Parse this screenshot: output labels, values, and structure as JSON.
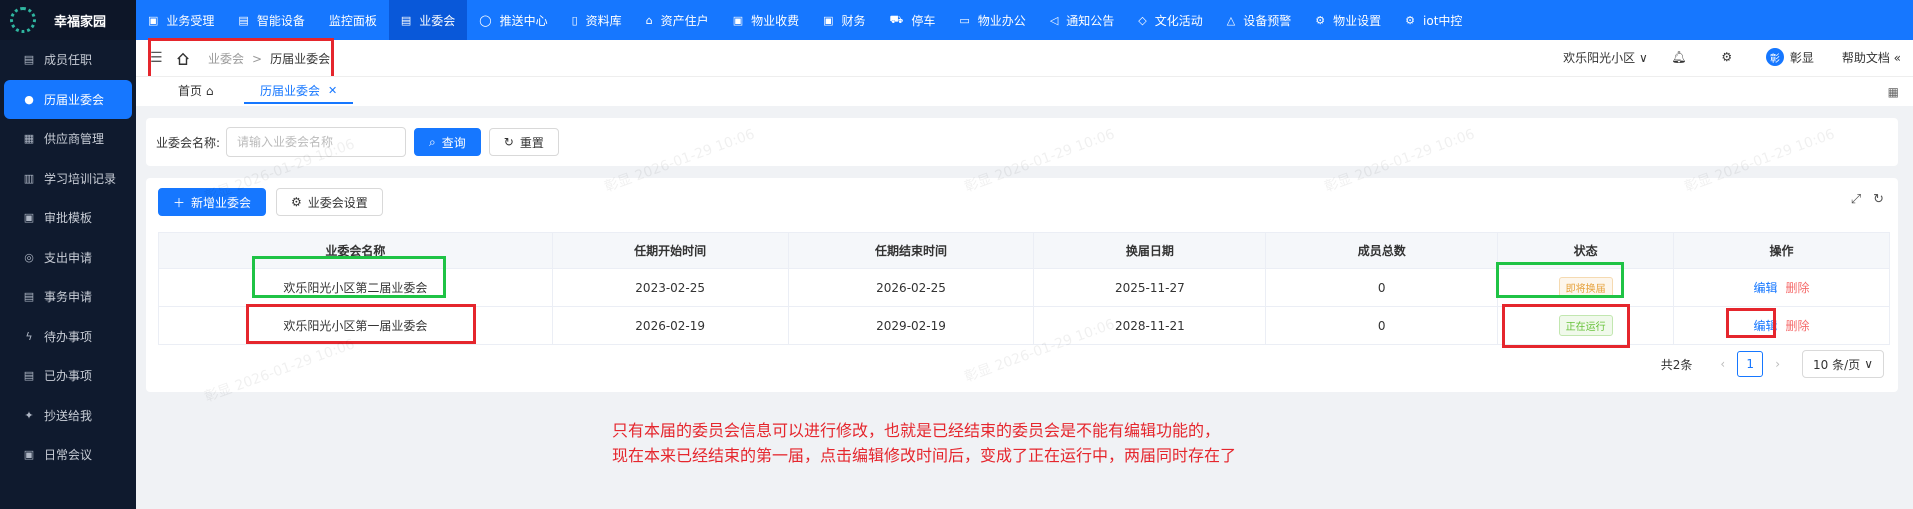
{
  "app": {
    "title": "幸福家园"
  },
  "sidebar": {
    "items": [
      {
        "label": "成员任职",
        "icon": "id-card-icon",
        "glyph": "▤"
      },
      {
        "label": "历届业委会",
        "icon": "users-icon",
        "glyph": "●",
        "active": true
      },
      {
        "label": "供应商管理",
        "icon": "supplier-icon",
        "glyph": "▦"
      },
      {
        "label": "学习培训记录",
        "icon": "book-icon",
        "glyph": "▥"
      },
      {
        "label": "审批模板",
        "icon": "template-icon",
        "glyph": "▣"
      },
      {
        "label": "支出申请",
        "icon": "coin-icon",
        "glyph": "◎"
      },
      {
        "label": "事务申请",
        "icon": "document-icon",
        "glyph": "▤"
      },
      {
        "label": "待办事项",
        "icon": "lightning-icon",
        "glyph": "ϟ"
      },
      {
        "label": "已办事项",
        "icon": "list-icon",
        "glyph": "▤"
      },
      {
        "label": "抄送给我",
        "icon": "bird-icon",
        "glyph": "✦"
      },
      {
        "label": "日常会议",
        "icon": "calendar-icon",
        "glyph": "▣"
      }
    ]
  },
  "topnav": {
    "items": [
      {
        "label": "业务受理",
        "icon": "business-icon",
        "glyph": "▣"
      },
      {
        "label": "智能设备",
        "icon": "device-icon",
        "glyph": "▤"
      },
      {
        "label": "监控面板",
        "icon": "monitor-icon",
        "glyph": ""
      },
      {
        "label": "业委会",
        "icon": "committee-icon",
        "glyph": "▤",
        "active": true
      },
      {
        "label": "推送中心",
        "icon": "chat-icon",
        "glyph": "◯"
      },
      {
        "label": "资料库",
        "icon": "file-icon",
        "glyph": "▯"
      },
      {
        "label": "资产住户",
        "icon": "home-icon",
        "glyph": "⌂"
      },
      {
        "label": "物业收费",
        "icon": "bill-icon",
        "glyph": "▣"
      },
      {
        "label": "财务",
        "icon": "finance-icon",
        "glyph": "▣"
      },
      {
        "label": "停车",
        "icon": "car-icon",
        "glyph": "⛟"
      },
      {
        "label": "物业办公",
        "icon": "desktop-icon",
        "glyph": "▭"
      },
      {
        "label": "通知公告",
        "icon": "megaphone-icon",
        "glyph": "◁"
      },
      {
        "label": "文化活动",
        "icon": "tag-icon",
        "glyph": "◇"
      },
      {
        "label": "设备预警",
        "icon": "alarm-icon",
        "glyph": "△"
      },
      {
        "label": "物业设置",
        "icon": "gear-icon",
        "glyph": "⚙"
      },
      {
        "label": "iot中控",
        "icon": "iot-icon",
        "glyph": "⚙"
      }
    ]
  },
  "header": {
    "breadcrumb": [
      "业委会",
      "历届业委会"
    ],
    "community": "欢乐阳光小区",
    "username": "彰显",
    "avatar_initial": "彰",
    "help": "帮助文档"
  },
  "tabs": [
    {
      "label": "首页"
    },
    {
      "label": "历届业委会",
      "active": true
    }
  ],
  "search": {
    "label": "业委会名称:",
    "placeholder": "请输入业委会名称",
    "query_btn": "查询",
    "reset_btn": "重置"
  },
  "toolbar": {
    "add_btn": "新增业委会",
    "settings_btn": "业委会设置"
  },
  "table": {
    "headers": [
      "业委会名称",
      "任期开始时间",
      "任期结束时间",
      "换届日期",
      "成员总数",
      "状态",
      "操作"
    ],
    "rows": [
      {
        "name": "欢乐阳光小区第二届业委会",
        "start": "2023-02-25",
        "end": "2026-02-25",
        "change": "2025-11-27",
        "members": "0",
        "status": "即将换届",
        "status_type": "warn",
        "edit": "编辑",
        "delete": "删除"
      },
      {
        "name": "欢乐阳光小区第一届业委会",
        "start": "2026-02-19",
        "end": "2029-02-19",
        "change": "2028-11-21",
        "members": "0",
        "status": "正在运行",
        "status_type": "ok",
        "edit": "编辑",
        "delete": "删除"
      }
    ]
  },
  "pager": {
    "total": "共2条",
    "page": "1",
    "size": "10 条/页"
  },
  "annotation": {
    "line1": "只有本届的委员会信息可以进行修改，也就是已经结束的委员会是不能有编辑功能的，",
    "line2": "现在本来已经结束的第一届，点击编辑修改时间后，变成了正在运行中，两届同时存在了"
  },
  "watermark": "彰显 2026-01-29 10:06",
  "colors": {
    "primary": "#1677ff",
    "sidebar": "#0f1a2e",
    "annotation_red": "#e5262d",
    "annotation_green": "#1fc345"
  }
}
